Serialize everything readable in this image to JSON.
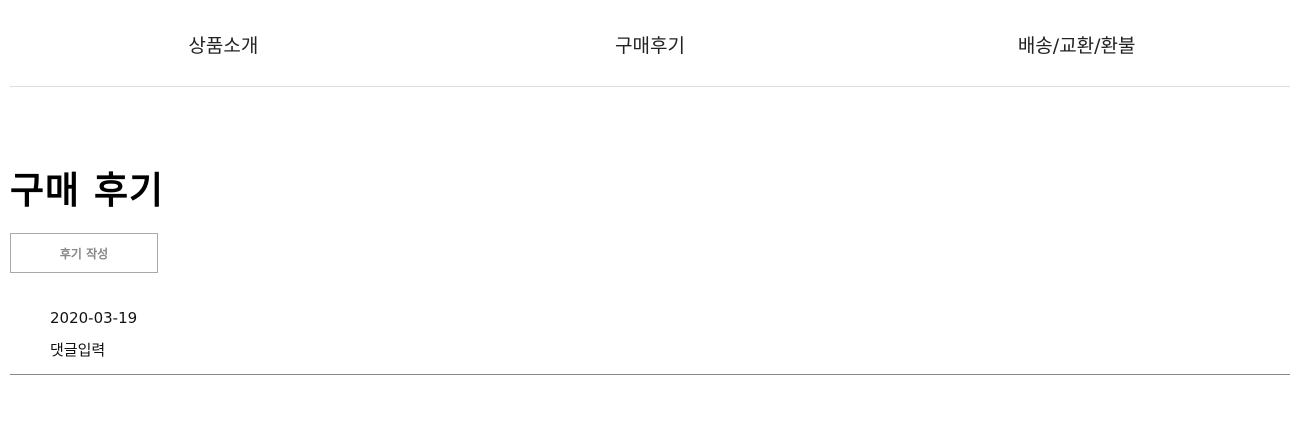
{
  "tabs": [
    {
      "label": "상품소개"
    },
    {
      "label": "구매후기"
    },
    {
      "label": "배송/교환/환불"
    }
  ],
  "reviews_section": {
    "title": "구매 후기",
    "write_button_label": "후기 작성",
    "items": [
      {
        "date": "2020-03-19",
        "comment": "댓글입력"
      }
    ]
  }
}
